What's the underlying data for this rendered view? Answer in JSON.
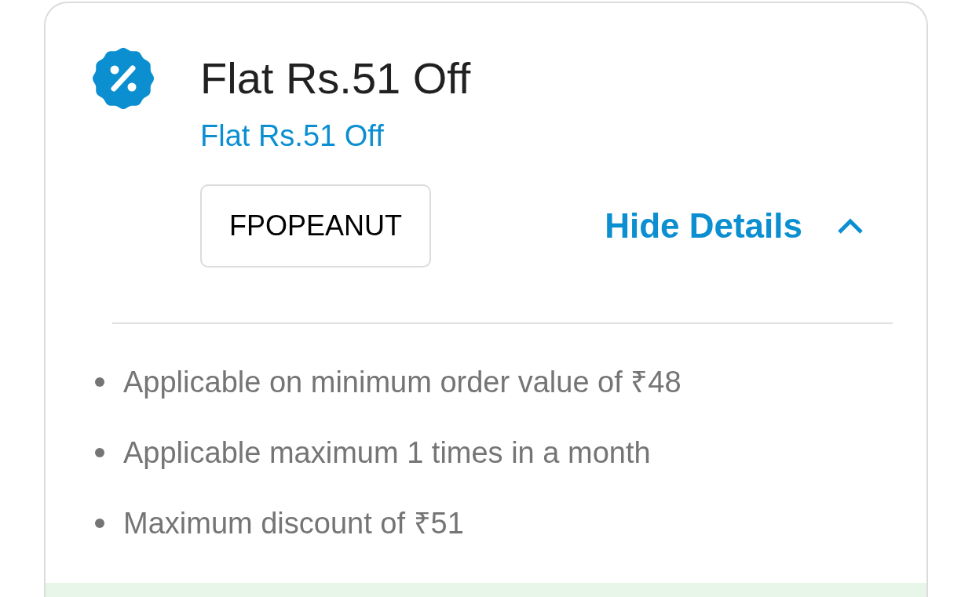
{
  "offer": {
    "title": "Flat Rs.51 Off",
    "subtitle": "Flat Rs.51 Off",
    "code": "FPOPEANUT",
    "details_toggle": {
      "label": "Hide Details",
      "expanded": true
    },
    "terms": [
      {
        "text": "Applicable on minimum order value of ₹48"
      },
      {
        "text": "Applicable maximum 1 times in a month"
      },
      {
        "text": "Maximum discount of ₹51"
      }
    ]
  }
}
